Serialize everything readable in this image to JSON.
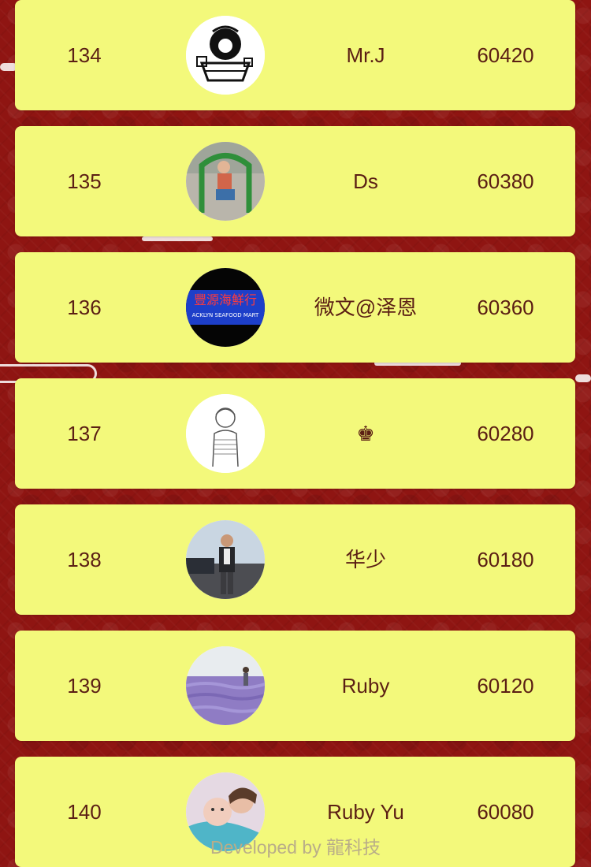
{
  "leaderboard": {
    "rows": [
      {
        "rank": "134",
        "name": "Mr.J",
        "score": "60420",
        "avatar_icon": "cartoon-boat-icon"
      },
      {
        "rank": "135",
        "name": "Ds",
        "score": "60380",
        "avatar_icon": "child-playground-photo"
      },
      {
        "rank": "136",
        "name": "微文@泽恩",
        "score": "60360",
        "avatar_icon": "seafood-mart-sign-photo"
      },
      {
        "rank": "137",
        "name": "♚",
        "score": "60280",
        "avatar_icon": "sketch-boy-icon"
      },
      {
        "rank": "138",
        "name": "华少",
        "score": "60180",
        "avatar_icon": "man-standing-photo"
      },
      {
        "rank": "139",
        "name": "Ruby",
        "score": "60120",
        "avatar_icon": "lavender-field-photo"
      },
      {
        "rank": "140",
        "name": "Ruby Yu",
        "score": "60080",
        "avatar_icon": "mother-baby-photo"
      }
    ],
    "avatar_text": {
      "sign_top": "豐源海鮮行",
      "sign_bottom": "ACKLYN SEAFOOD MART"
    }
  },
  "footer": {
    "text": "Developed by 龍科技"
  },
  "colors": {
    "background": "#8f1512",
    "card": "#f3f97b",
    "text": "#5b1f14",
    "footer_text": "#b9ad88"
  }
}
